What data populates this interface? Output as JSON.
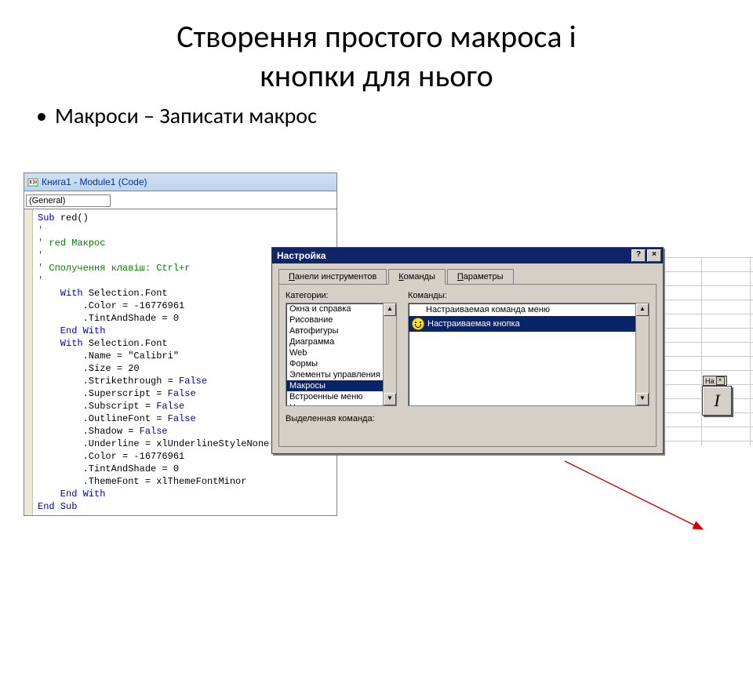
{
  "title_line1": "Створення простого макроса і",
  "title_line2": "кнопки для нього",
  "bullet": "Макроси – Записати макрос",
  "codewin": {
    "title": "Книга1 - Module1 (Code)",
    "dropdown": "(General)",
    "lines": [
      {
        "t": "Sub ",
        "cls": "kw"
      },
      {
        "t": "red()\n",
        "cls": ""
      },
      {
        "t": "'\n",
        "cls": "cm"
      },
      {
        "t": "' red Макрос\n",
        "cls": "cm"
      },
      {
        "t": "'\n",
        "cls": "cm"
      },
      {
        "t": "' Сполучення клавіш: Ctrl+r\n",
        "cls": "cm"
      },
      {
        "t": "'\n",
        "cls": "cm"
      },
      {
        "t": "    With ",
        "cls": "kw"
      },
      {
        "t": "Selection.Font\n",
        "cls": ""
      },
      {
        "t": "        .Color = -16776961\n",
        "cls": ""
      },
      {
        "t": "        .TintAndShade = 0\n",
        "cls": ""
      },
      {
        "t": "    End With\n",
        "cls": "kw"
      },
      {
        "t": "    With ",
        "cls": "kw"
      },
      {
        "t": "Selection.Font\n",
        "cls": ""
      },
      {
        "t": "        .Name = \"Calibri\"\n",
        "cls": ""
      },
      {
        "t": "        .Size = 20\n",
        "cls": ""
      },
      {
        "t": "        .Strikethrough = ",
        "cls": ""
      },
      {
        "t": "False\n",
        "cls": "kw"
      },
      {
        "t": "        .Superscript = ",
        "cls": ""
      },
      {
        "t": "False\n",
        "cls": "kw"
      },
      {
        "t": "        .Subscript = ",
        "cls": ""
      },
      {
        "t": "False\n",
        "cls": "kw"
      },
      {
        "t": "        .OutlineFont = ",
        "cls": ""
      },
      {
        "t": "False\n",
        "cls": "kw"
      },
      {
        "t": "        .Shadow = ",
        "cls": ""
      },
      {
        "t": "False\n",
        "cls": "kw"
      },
      {
        "t": "        .Underline = xlUnderlineStyleNone\n",
        "cls": ""
      },
      {
        "t": "        .Color = -16776961\n",
        "cls": ""
      },
      {
        "t": "        .TintAndShade = 0\n",
        "cls": ""
      },
      {
        "t": "        .ThemeFont = xlThemeFontMinor\n",
        "cls": ""
      },
      {
        "t": "    End With\n",
        "cls": "kw"
      },
      {
        "t": "End Sub",
        "cls": "kw"
      }
    ]
  },
  "dialog": {
    "title": "Настройка",
    "help": "?",
    "close": "×",
    "tabs": [
      "Панели инструментов",
      "Команды",
      "Параметры"
    ],
    "active_tab": 1,
    "categories_label": "Категории:",
    "commands_label": "Команды:",
    "categories": [
      "Окна и справка",
      "Рисование",
      "Автофигуры",
      "Диаграмма",
      "Web",
      "Формы",
      "Элементы управления",
      "Макросы",
      "Встроенные меню",
      "Новое меню"
    ],
    "categories_selected": 7,
    "commands": [
      "Настраиваемая команда меню",
      "Настраиваемая кнопка"
    ],
    "commands_selected": 1,
    "selected_cmd_label": "Выделенная команда:"
  },
  "dropped_btn_hdr": "На",
  "dropped_btn_glyph": "I"
}
